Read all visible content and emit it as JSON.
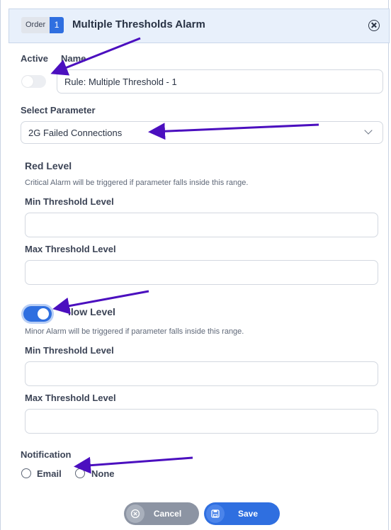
{
  "header": {
    "order_label": "Order",
    "order_number": "1",
    "title": "Multiple Thresholds Alarm"
  },
  "form": {
    "active_label": "Active",
    "active_toggle": "off",
    "name_label": "Name",
    "name_value": "Rule: Multiple Threshold - 1",
    "select_parameter_label": "Select Parameter",
    "select_parameter_value": "2G Failed Connections"
  },
  "red_level": {
    "title": "Red Level",
    "hint": "Critical Alarm will be triggered if parameter falls inside this range.",
    "min_label": "Min Threshold Level",
    "max_label": "Max Threshold Level",
    "min_value": "",
    "max_value": ""
  },
  "yellow_level": {
    "title": "Yellow Level",
    "visible_title": "llow Level",
    "toggle": "on",
    "hint": "Minor Alarm will be triggered if parameter falls inside this range.",
    "min_label": "Min Threshold Level",
    "max_label": "Max Threshold Level",
    "min_value": "",
    "max_value": ""
  },
  "notification": {
    "label": "Notification",
    "options": [
      "Email",
      "None"
    ]
  },
  "buttons": {
    "cancel": "Cancel",
    "save": "Save"
  },
  "icons": [
    "close-icon",
    "chevron-down-icon",
    "cancel-circle-icon",
    "save-disk-icon"
  ],
  "colors": {
    "accent": "#2f6fe0",
    "header_bg": "#e8f0fb",
    "arrow": "#4b0fbf"
  }
}
